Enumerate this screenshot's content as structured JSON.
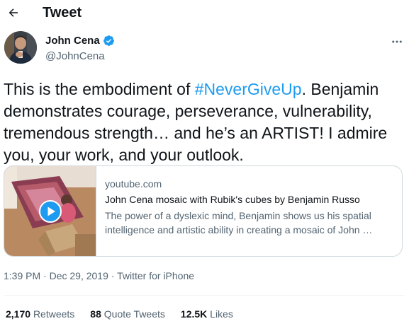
{
  "header": {
    "title": "Tweet",
    "back_icon": "arrow-left-icon"
  },
  "author": {
    "display_name": "John Cena",
    "handle": "@JohnCena",
    "verified": true,
    "verified_color": "#1d9bf0"
  },
  "tweet": {
    "text_before_hashtag": "This is the embodiment of ",
    "hashtag": "#NeverGiveUp",
    "text_after_hashtag": ". Benjamin demonstrates courage, perseverance, vulnerability, tremendous strength… and he’s an ARTIST! I admire you, your work, and your outlook."
  },
  "card": {
    "domain": "youtube.com",
    "title": "John Cena mosaic with Rubik's cubes by Benjamin Russo",
    "description": "The power of a dyslexic mind, Benjamin shows us his spatial intelligence and artistic ability in creating a mosaic of John …",
    "play_icon": "play-circle-icon"
  },
  "meta": {
    "time": "1:39 PM",
    "separator": " · ",
    "date": "Dec 29, 2019",
    "source": "Twitter for iPhone"
  },
  "stats": {
    "retweets_count": "2,170",
    "retweets_label": "Retweets",
    "quotes_count": "88",
    "quotes_label": "Quote Tweets",
    "likes_count": "12.5K",
    "likes_label": "Likes"
  },
  "colors": {
    "accent": "#1d9bf0",
    "text_primary": "#0f1419",
    "text_secondary": "#536471",
    "border": "#cfd9de"
  }
}
